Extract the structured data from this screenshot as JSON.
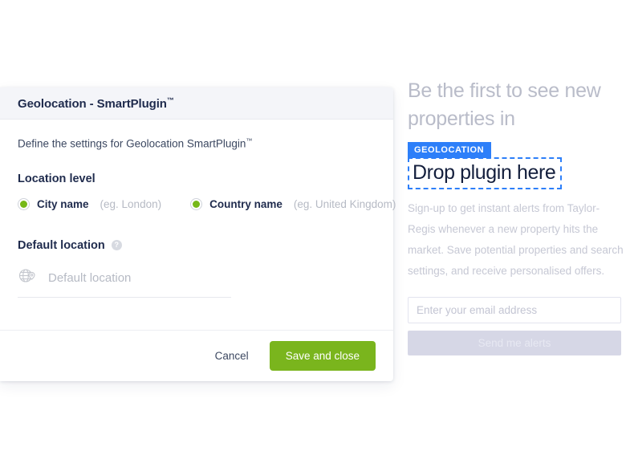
{
  "dialog": {
    "title": "Geolocation - SmartPlugin",
    "title_tm": "™",
    "description": "Define the settings for Geolocation SmartPlugin",
    "description_tm": "™",
    "location_level": {
      "label": "Location level",
      "options": [
        {
          "label": "City name",
          "hint": "(eg. London)",
          "selected": true
        },
        {
          "label": "Country name",
          "hint": "(eg. United Kingdom)",
          "selected": true
        }
      ]
    },
    "default_location": {
      "label": "Default location",
      "help_glyph": "?",
      "placeholder": "Default location",
      "icon": "globe-location-icon"
    },
    "footer": {
      "cancel_label": "Cancel",
      "save_label": "Save and close"
    },
    "colors": {
      "header_bg": "#f4f5f9",
      "title_text": "#1f2b4d",
      "radio_fill": "#76b818",
      "save_button": "#7ab51d"
    }
  },
  "preview": {
    "heading": "Be the first to see new properties in",
    "badge_label": "GEOLOCATION",
    "dropzone_label": "Drop plugin here",
    "body": "Sign-up to get instant alerts from Taylor-Regis whenever a new property hits the market. Save potential properties and search settings, and receive personalised offers.",
    "email_placeholder": "Enter your email address",
    "alerts_button_label": "Send me alerts",
    "colors": {
      "badge_bg": "#2d7ff9",
      "dropzone_border": "#2d7ff9",
      "heading_text": "#b9bcc9",
      "alerts_button_bg": "#d6d7e6"
    }
  }
}
